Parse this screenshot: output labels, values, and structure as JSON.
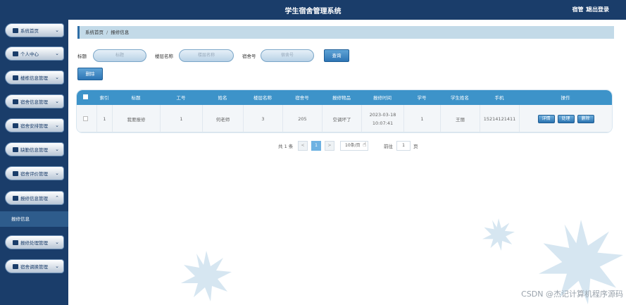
{
  "header": {
    "title": "学生宿舍管理系统",
    "user": "宿管 1",
    "logout": "退出登录"
  },
  "sidebar": {
    "items": [
      {
        "label": "系统首页"
      },
      {
        "label": "个人中心"
      },
      {
        "label": "楼栋信息管理"
      },
      {
        "label": "宿舍信息管理"
      },
      {
        "label": "宿舍安排管理"
      },
      {
        "label": "缺勤信息管理"
      },
      {
        "label": "宿舍评价管理"
      },
      {
        "label": "报修信息管理"
      },
      {
        "label": "报修处理管理"
      },
      {
        "label": "宿舍调换管理"
      }
    ],
    "active_sub": "报修信息"
  },
  "breadcrumb": {
    "home": "系统首页",
    "sep": "/",
    "current": "报修信息"
  },
  "search": {
    "title_label": "标题",
    "title_placeholder": "标题",
    "building_label": "楼层名称",
    "building_placeholder": "楼层名称",
    "room_label": "宿舍号",
    "room_placeholder": "宿舍号",
    "query_button": "查询"
  },
  "toolbar": {
    "delete_label": "删除"
  },
  "table": {
    "headers": [
      "索引",
      "标题",
      "工号",
      "姓名",
      "楼层名称",
      "宿舍号",
      "报修物品",
      "报修时间",
      "学号",
      "学生姓名",
      "手机",
      "操作"
    ],
    "rows": [
      {
        "index": "1",
        "title": "我要报修",
        "job_no": "1",
        "name": "何老师",
        "building": "3",
        "room": "205",
        "item": "空调坏了",
        "time": "2023-03-18 10:07:41",
        "student_no": "1",
        "student_name": "王丽",
        "phone": "15214121411"
      }
    ],
    "actions": [
      "详情",
      "处理",
      "删除"
    ]
  },
  "pager": {
    "total": "共 1 条",
    "page": "1",
    "prev": "<",
    "next": ">",
    "size": "10条/页",
    "goto_label": "前往",
    "goto_value": "1",
    "page_unit": "页"
  },
  "watermark": "CSDN @杰记计算机程序源码",
  "colors": {
    "nav": "#1a3d6a",
    "accent": "#3d93c9",
    "button": "#2d75b4"
  }
}
